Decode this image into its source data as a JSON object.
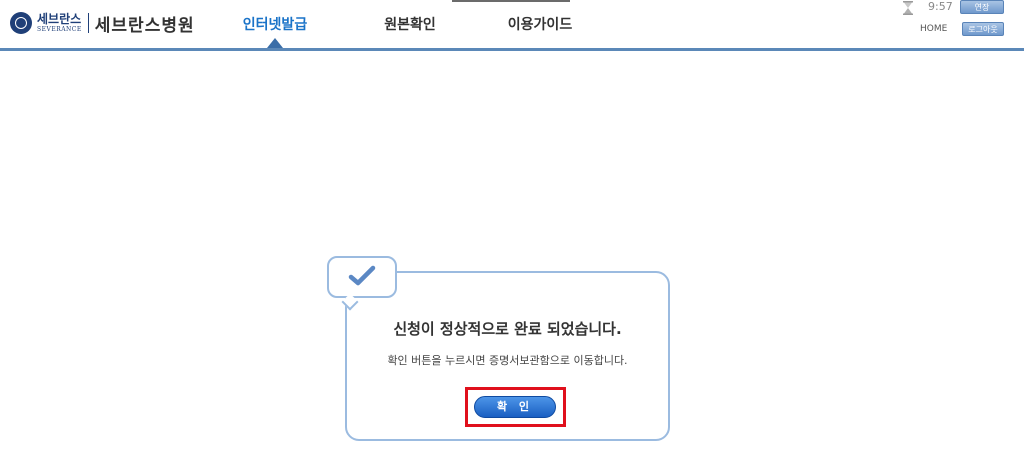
{
  "header": {
    "logo_small_ko": "세브란스",
    "logo_small_en": "SEVERANCE",
    "logo_big": "세브란스병원",
    "nav": [
      {
        "label": "인터넷발급",
        "active": true
      },
      {
        "label": "원본확인",
        "active": false
      },
      {
        "label": "이용가이드",
        "active": false
      }
    ],
    "session_time": "9:57",
    "extend_label": "연장",
    "home_label": "HOME",
    "logout_label": "로그아웃"
  },
  "dialog": {
    "title": "신청이 정상적으로 완료 되었습니다.",
    "description": "확인 버튼을 누르시면 증명서보관함으로 이동합니다.",
    "confirm_label": "확 인",
    "icon": "check-icon"
  },
  "colors": {
    "accent": "#1a73c8",
    "header_line": "#5b88b8",
    "dialog_border": "#9bbbe0",
    "highlight": "#e0101c",
    "button": "#1a5fc2"
  }
}
